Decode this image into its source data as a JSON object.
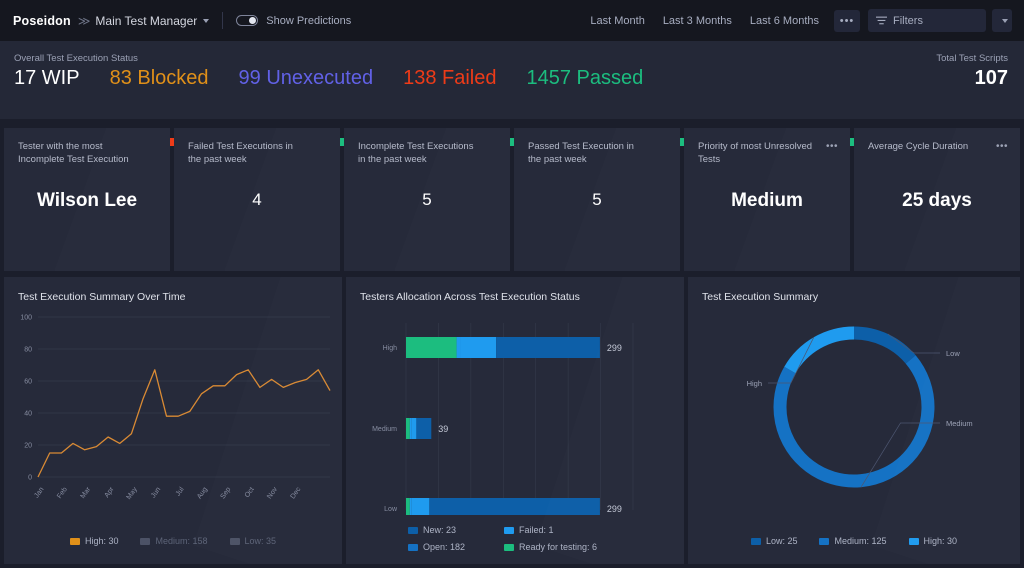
{
  "header": {
    "brand": "Poseidon",
    "breadcrumb_sep": "≫",
    "crumb": "Main Test Manager",
    "toggle_label": "Show Predictions",
    "toggle_state": "off",
    "ranges": [
      "Last Month",
      "Last 3 Months",
      "Last 6 Months"
    ],
    "more_label": "•••",
    "filters_label": "Filters"
  },
  "status": {
    "label": "Overall Test Execution Status",
    "total_label": "Total Test Scripts",
    "total_value": "107",
    "items": [
      {
        "text": "17 WIP",
        "value": 17,
        "color": "#ffffff"
      },
      {
        "text": "83 Blocked",
        "value": 83,
        "color": "#e09019"
      },
      {
        "text": "99 Unexecuted",
        "value": 99,
        "color": "#6161e6"
      },
      {
        "text": "138 Failed",
        "value": 138,
        "color": "#ee3b18"
      },
      {
        "text": "1457 Passed",
        "value": 1457,
        "color": "#1cbd7f"
      }
    ]
  },
  "kpis": [
    {
      "title": "Tester with the most Incomplete Test  Execution",
      "value": "Wilson Lee",
      "dots": "",
      "big": true
    },
    {
      "title": "Failed Test Executions in the past week",
      "value": "4",
      "dots": "",
      "big": false
    },
    {
      "title": "Incomplete Test Executions in the past week",
      "value": "5",
      "dots": "",
      "big": false
    },
    {
      "title": "Passed Test Execution in the past week",
      "value": "5",
      "dots": "",
      "big": false
    },
    {
      "title": "Priority of most Unresolved Tests",
      "value": "Medium",
      "dots": "•••",
      "big": true
    },
    {
      "title": "Average Cycle Duration",
      "value": "25 days",
      "dots": "•••",
      "big": true
    }
  ],
  "panels": {
    "line_title": "Test Execution Summary Over Time",
    "bar_title": "Testers Allocation Across Test Execution Status",
    "donut_title": "Test Execution Summary"
  },
  "chart_data": [
    {
      "type": "line",
      "title": "Test Execution Summary Over Time",
      "xlabel": "",
      "ylabel": "",
      "ylim": [
        0,
        100
      ],
      "yticks": [
        0,
        20,
        40,
        60,
        80,
        100
      ],
      "grid": true,
      "legend_position": "bottom",
      "categories": [
        "Jan",
        "Feb",
        "Mar",
        "Apr",
        "May",
        "Jun",
        "Jul",
        "Aug",
        "Sep",
        "Oct",
        "Nov",
        "Dec"
      ],
      "x": [
        "Jan",
        "Jan",
        "Feb",
        "Feb",
        "Mar",
        "Mar",
        "Apr",
        "Apr",
        "May",
        "May",
        "Jun",
        "Jun",
        "Jul",
        "Jul",
        "Aug",
        "Aug",
        "Sep",
        "Sep",
        "Oct",
        "Oct",
        "Nov",
        "Nov",
        "Dec",
        "Dec"
      ],
      "series": [
        {
          "name": "High",
          "color": "#d98a34",
          "total": 30,
          "values": [
            0,
            15,
            15,
            21,
            17,
            19,
            25,
            21,
            27,
            49,
            67,
            38,
            38,
            41,
            52,
            57,
            57,
            64,
            67,
            56,
            61,
            56,
            59,
            61,
            67,
            54
          ]
        },
        {
          "name": "Medium",
          "color": "#5a6076",
          "total": 158,
          "values": []
        },
        {
          "name": "Low",
          "color": "#5a6076",
          "total": 35,
          "values": []
        }
      ],
      "legend": [
        {
          "label": "High: 30",
          "color": "#e09019",
          "active": true
        },
        {
          "label": "Medium: 158",
          "color": "#4c5266",
          "active": false
        },
        {
          "label": "Low: 35",
          "color": "#4c5266",
          "active": false
        }
      ]
    },
    {
      "type": "bar",
      "orientation": "horizontal",
      "stacked": true,
      "title": "Testers Allocation Across Test Execution Status",
      "xlabel": "",
      "ylabel": "",
      "xlim": [
        0,
        350
      ],
      "xticks": [
        0,
        50,
        100,
        150,
        200,
        250,
        300,
        350
      ],
      "grid": true,
      "legend_position": "bottom",
      "categories": [
        "High",
        "Medium",
        "Low"
      ],
      "totals": [
        "299",
        "39",
        "299"
      ],
      "series": [
        {
          "name": "Ready for testing",
          "color": "#1cbd7f",
          "values": [
            78,
            6,
            6
          ]
        },
        {
          "name": "Failed",
          "color": "#1f9bef",
          "values": [
            6,
            2,
            2
          ]
        },
        {
          "name": "Open",
          "color": "#1f9bef",
          "values": [
            55,
            8,
            28
          ]
        },
        {
          "name": "New",
          "color": "#0d5fa8",
          "values": [
            160,
            23,
            263
          ]
        }
      ],
      "legend": [
        {
          "label": "New: 23",
          "color": "#0d5fa8"
        },
        {
          "label": "Failed: 1",
          "color": "#1f9bef"
        },
        {
          "label": "Open: 182",
          "color": "#1572c4"
        },
        {
          "label": "Ready for testing: 6",
          "color": "#1cbd7f"
        }
      ]
    },
    {
      "type": "pie",
      "variant": "donut",
      "title": "Test Execution Summary",
      "legend_position": "bottom",
      "labels": [
        "Low",
        "Medium",
        "High"
      ],
      "values": [
        25,
        125,
        30
      ],
      "colors": [
        "#0d5fa8",
        "#1572c4",
        "#1f9bef"
      ],
      "annotations": [
        {
          "text": "Low",
          "at": "top-right"
        },
        {
          "text": "Medium",
          "at": "right-lower"
        },
        {
          "text": "High",
          "at": "left"
        }
      ],
      "legend": [
        {
          "label": "Low: 25",
          "color": "#0d5fa8"
        },
        {
          "label": "Medium: 125",
          "color": "#1572c4"
        },
        {
          "label": "High: 30",
          "color": "#1f9bef"
        }
      ]
    }
  ]
}
